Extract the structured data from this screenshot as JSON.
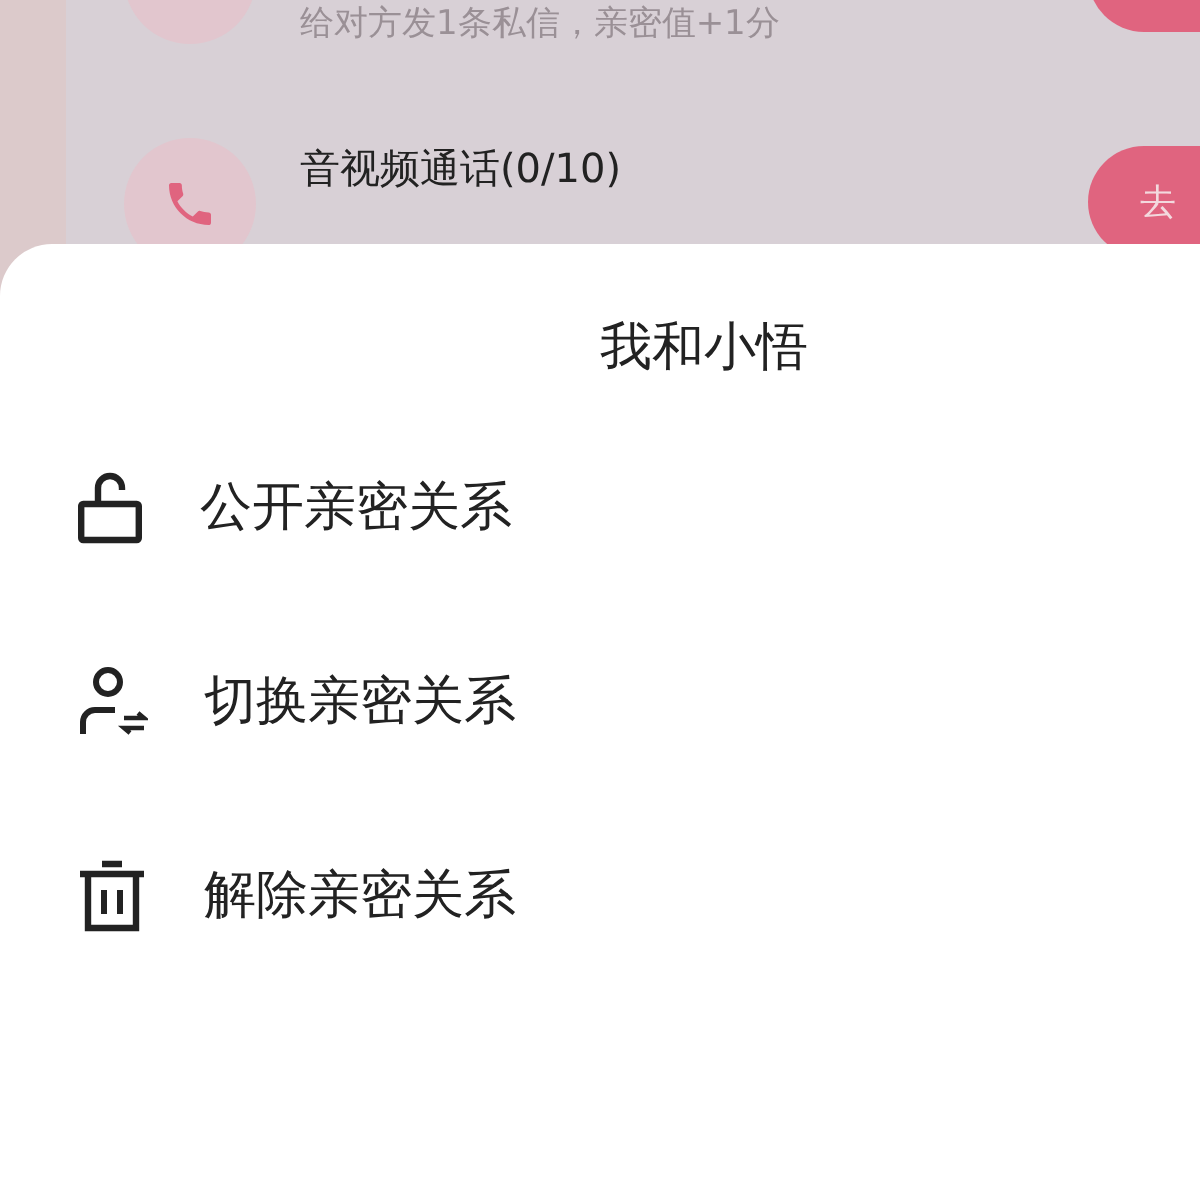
{
  "tasks": [
    {
      "subtitle": "给对方发1条私信，亲密值+1分",
      "has_button": true
    },
    {
      "title": "音视频通话(0/10)",
      "button": "去"
    }
  ],
  "sheet": {
    "title": "我和小悟",
    "items": [
      {
        "kind": "lock",
        "label": "公开亲密关系"
      },
      {
        "kind": "swap",
        "label": "切换亲密关系"
      },
      {
        "kind": "trash",
        "label": "解除亲密关系"
      }
    ]
  }
}
